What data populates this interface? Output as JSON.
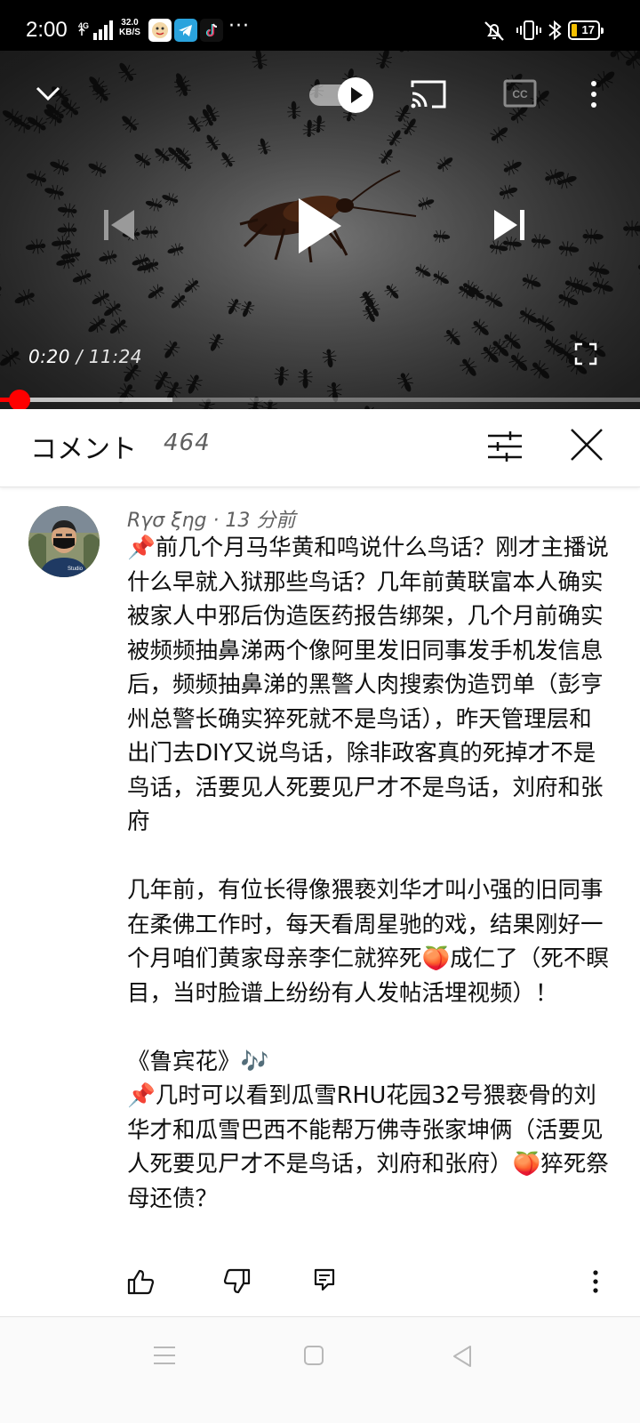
{
  "status_bar": {
    "time": "2:00",
    "network": "4G",
    "speed_value": "32.0",
    "speed_unit": "KB/S",
    "more": "···",
    "battery": "17"
  },
  "player": {
    "current_time": "0:20",
    "separator": " / ",
    "duration": "11:24",
    "progress": 0.03,
    "buffered": 0.27,
    "autoplay_on": true
  },
  "comments_header": {
    "title": "コメント",
    "count": "464"
  },
  "comment": {
    "author": "Rγσ ξηg",
    "meta_separator": " · ",
    "time_ago": "13 分前",
    "body": "📌前几个月马华黄和鸣说什么鸟话？刚才主播说什么早就入狱那些鸟话？几年前黄联富本人确实被家人中邪后伪造医药报告绑架，几个月前确实被频频抽鼻涕两个像阿里发旧同事发手机发信息后，频频抽鼻涕的黑警人肉搜索伪造罚单（彭亨州总警长确实猝死就不是鸟话），昨天管理层和出门去DIY又说鸟话，除非政客真的死掉才不是鸟话，活要见人死要见尸才不是鸟话，刘府和张府\n\n几年前，有位长得像猥亵刘华才叫小强的旧同事在柔佛工作时，每天看周星驰的戏，结果刚好一个月咱们黄家母亲李仁就猝死🍑成仁了（死不瞑目，当时脸谱上纷纷有人发帖活埋视频）！\n\n《鲁宾花》🎶\n📌几时可以看到瓜雪RHU花园32号猥亵骨的刘华才和瓜雪巴西不能帮万佛寺张家坤俩（活要见人死要见尸才不是鸟话，刘府和张府）🍑猝死祭母还债？"
  }
}
